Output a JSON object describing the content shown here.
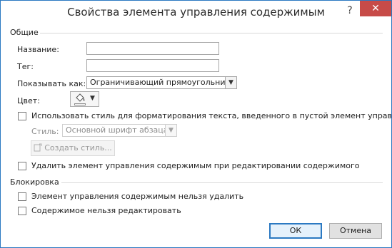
{
  "window": {
    "title": "Свойства элемента управления содержимым",
    "help_label": "?",
    "close_label": "✕"
  },
  "general": {
    "section_label": "Общие",
    "name_label": "Название:",
    "name_value": "",
    "tag_label": "Тег:",
    "tag_value": "",
    "show_as_label": "Показывать как:",
    "show_as_value": "Ограничивающий прямоугольник",
    "color_label": "Цвет:",
    "use_style_label": "Использовать стиль для форматирования текста, введенного в пустой элемент управления",
    "style_label": "Стиль:",
    "style_value": "Основной шрифт абзаца",
    "create_style_label": "Создать стиль...",
    "remove_on_edit_label": "Удалить элемент управления содержимым при редактировании содержимого"
  },
  "locking": {
    "section_label": "Блокировка",
    "cannot_delete_label": "Элемент управления содержимым нельзя удалить",
    "cannot_edit_label": "Содержимое нельзя редактировать"
  },
  "buttons": {
    "ok_label": "ОК",
    "cancel_label": "Отмена"
  },
  "colors": {
    "accent": "#2b79c2",
    "close_bg": "#c74b48"
  }
}
